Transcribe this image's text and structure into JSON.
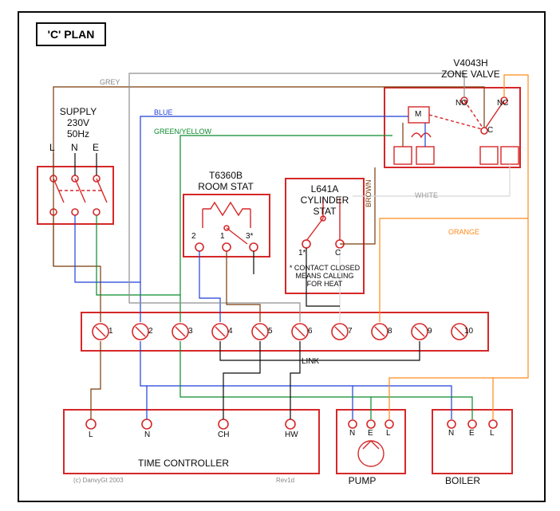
{
  "title": "'C' PLAN",
  "supply": {
    "label": "SUPPLY",
    "voltage": "230V",
    "freq": "50Hz",
    "pins": [
      "L",
      "N",
      "E"
    ]
  },
  "zone_valve": {
    "model": "V4043H",
    "label": "ZONE VALVE",
    "pins": {
      "M": "M",
      "NO": "NO",
      "NC": "NC",
      "C": "C"
    }
  },
  "room_stat": {
    "model": "T6360B",
    "label": "ROOM STAT",
    "pins": [
      "2",
      "1",
      "3*"
    ]
  },
  "cylinder_stat": {
    "model": "L641A",
    "label": "CYLINDER",
    "label2": "STAT",
    "pins": [
      "1*",
      "C"
    ],
    "note1": "* CONTACT CLOSED",
    "note2": "MEANS CALLING",
    "note3": "FOR HEAT"
  },
  "terminal_strip": {
    "pins": [
      "1",
      "2",
      "3",
      "4",
      "5",
      "6",
      "7",
      "8",
      "9",
      "10"
    ],
    "link": "LINK"
  },
  "time_ctrl": {
    "label": "TIME CONTROLLER",
    "pins": [
      "L",
      "N",
      "CH",
      "HW"
    ]
  },
  "pump": {
    "label": "PUMP",
    "pins": [
      "N",
      "E",
      "L"
    ]
  },
  "boiler": {
    "label": "BOILER",
    "pins": [
      "N",
      "E",
      "L"
    ]
  },
  "wire_labels": {
    "grey": "GREY",
    "blue": "BLUE",
    "gy": "GREEN/YELLOW",
    "brown": "BROWN",
    "white": "WHITE",
    "orange": "ORANGE"
  },
  "footer": {
    "copyright": "(c) DanvyGt 2003",
    "rev": "Rev1d"
  }
}
